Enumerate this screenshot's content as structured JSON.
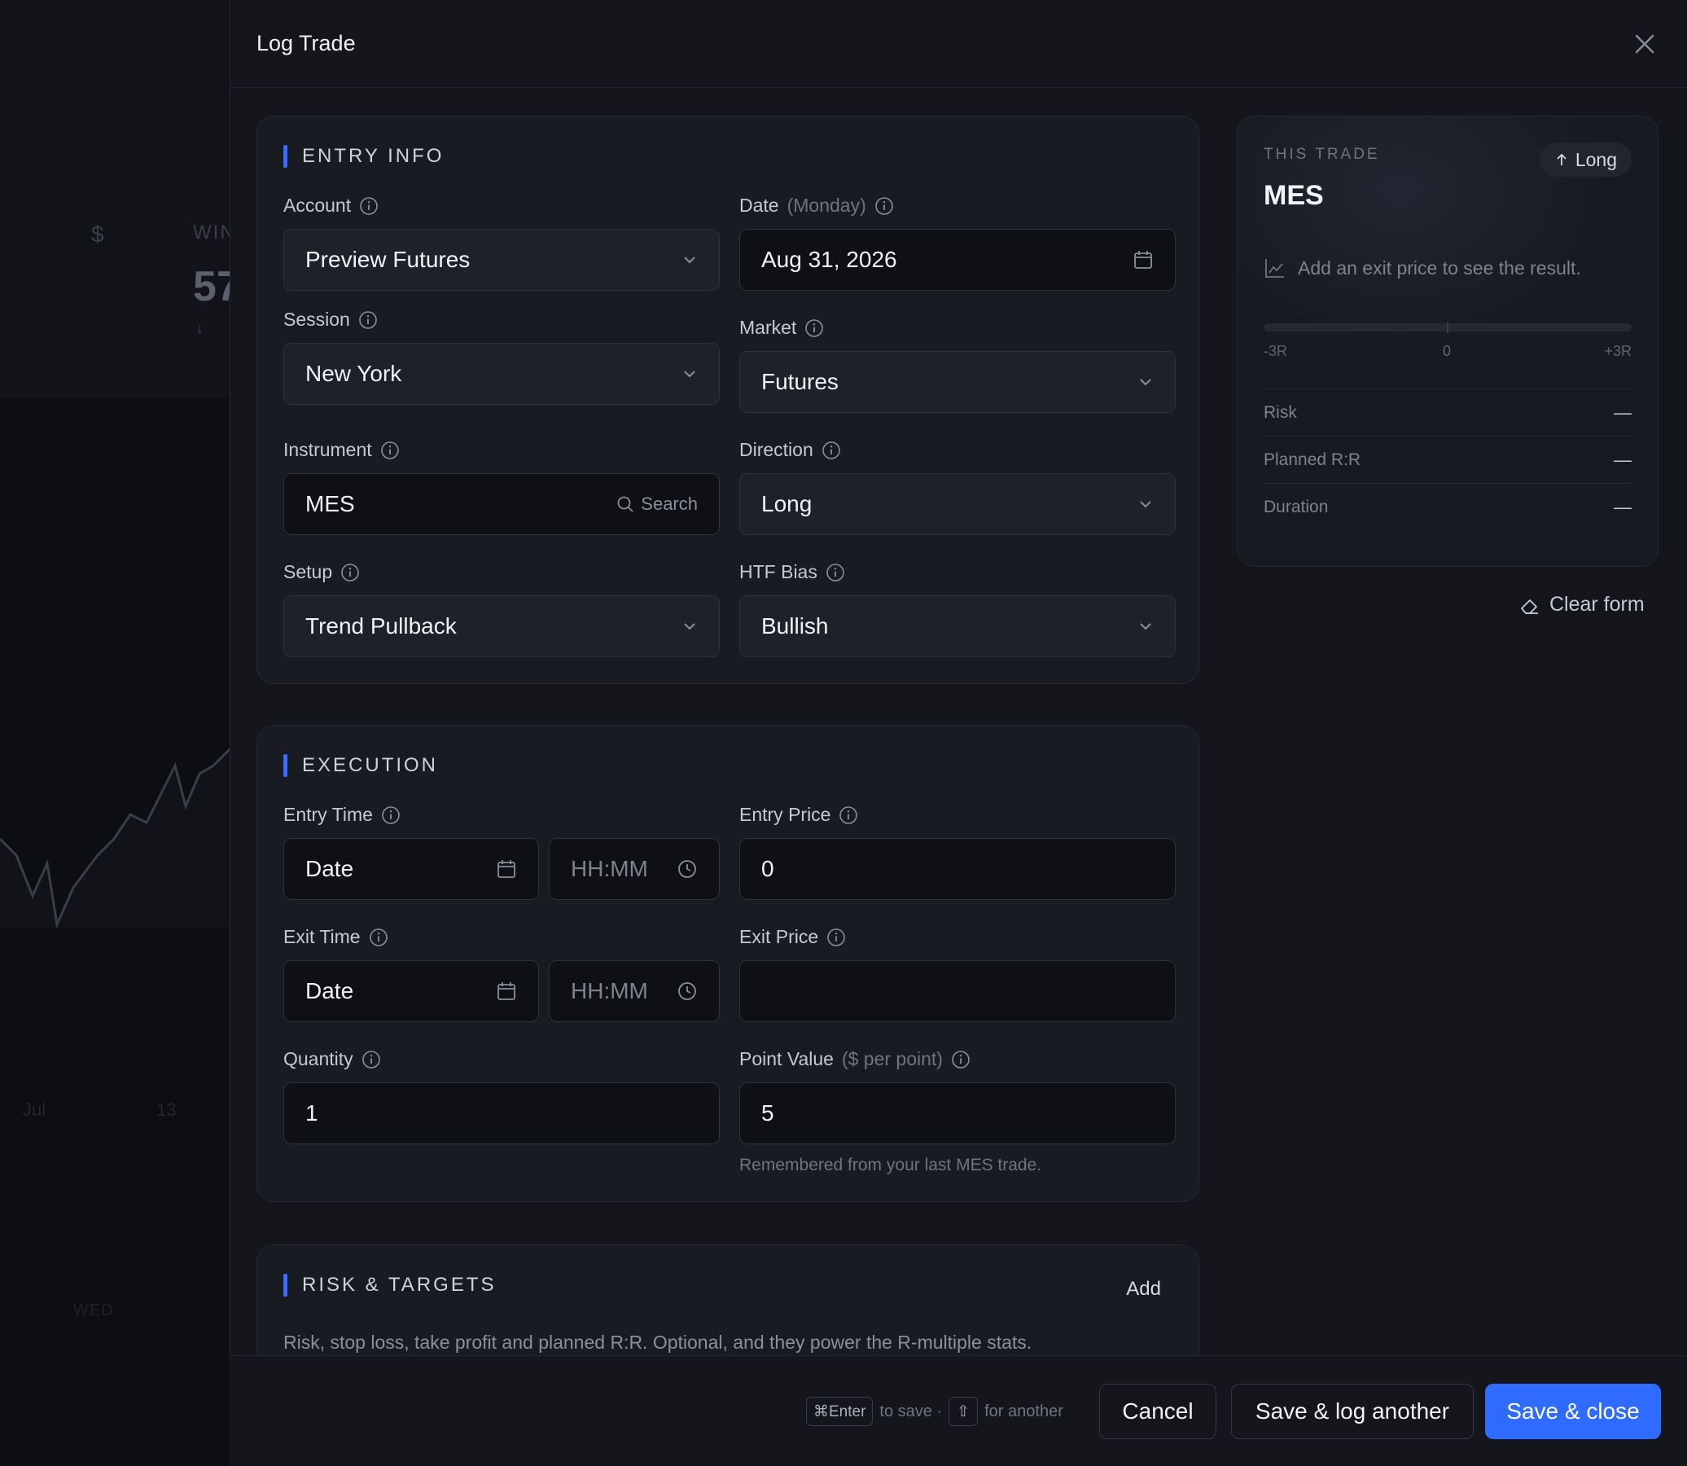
{
  "background": {
    "stat_label": "WIN",
    "stat_value": "57",
    "axis_month": "Jul",
    "axis_day": "13",
    "weekday": "WED"
  },
  "drawer": {
    "title": "Log Trade"
  },
  "entry_info": {
    "title": "ENTRY INFO",
    "account": {
      "label": "Account",
      "value": "Preview Futures"
    },
    "date": {
      "label": "Date",
      "label_suffix": "(Monday)",
      "value": "Aug 31, 2026"
    },
    "session": {
      "label": "Session",
      "value": "New York"
    },
    "market": {
      "label": "Market",
      "value": "Futures"
    },
    "instrument": {
      "label": "Instrument",
      "value": "MES",
      "search_label": "Search"
    },
    "direction": {
      "label": "Direction",
      "value": "Long"
    },
    "setup": {
      "label": "Setup",
      "value": "Trend Pullback"
    },
    "htf_bias": {
      "label": "HTF Bias",
      "value": "Bullish"
    }
  },
  "execution": {
    "title": "EXECUTION",
    "entry_time": {
      "label": "Entry Time",
      "date_placeholder": "Date",
      "time_placeholder": "HH:MM"
    },
    "entry_price": {
      "label": "Entry Price",
      "value": "0"
    },
    "exit_time": {
      "label": "Exit Time",
      "date_placeholder": "Date",
      "time_placeholder": "HH:MM"
    },
    "exit_price": {
      "label": "Exit Price",
      "value": ""
    },
    "quantity": {
      "label": "Quantity",
      "value": "1"
    },
    "point_value": {
      "label": "Point Value",
      "label_suffix": "($ per point)",
      "value": "5",
      "helper": "Remembered from your last MES trade."
    }
  },
  "risk_targets": {
    "title": "RISK & TARGETS",
    "action": "Add",
    "description": "Risk, stop loss, take profit and planned R:R. Optional, and they power the R-multiple stats."
  },
  "summary": {
    "kicker": "THIS TRADE",
    "symbol": "MES",
    "direction": "Long",
    "hint": "Add an exit price to see the result.",
    "scale": {
      "min_label": "-3R",
      "mid_label": "0",
      "max_label": "+3R"
    },
    "rows": [
      {
        "label": "Risk",
        "value": "—"
      },
      {
        "label": "Planned R:R",
        "value": "—"
      },
      {
        "label": "Duration",
        "value": "—"
      }
    ]
  },
  "clear_form": "Clear form",
  "footer": {
    "kbd_save": "⌘Enter",
    "save_text": "to save ·",
    "kbd_another": "⇧",
    "another_text": "for another",
    "cancel": "Cancel",
    "save_another": "Save & log another",
    "save_close": "Save & close"
  },
  "colors": {
    "accent": "#2f6bff",
    "section_bar": "#3b6cff",
    "surface": "#14161c",
    "card": "#191b22"
  }
}
